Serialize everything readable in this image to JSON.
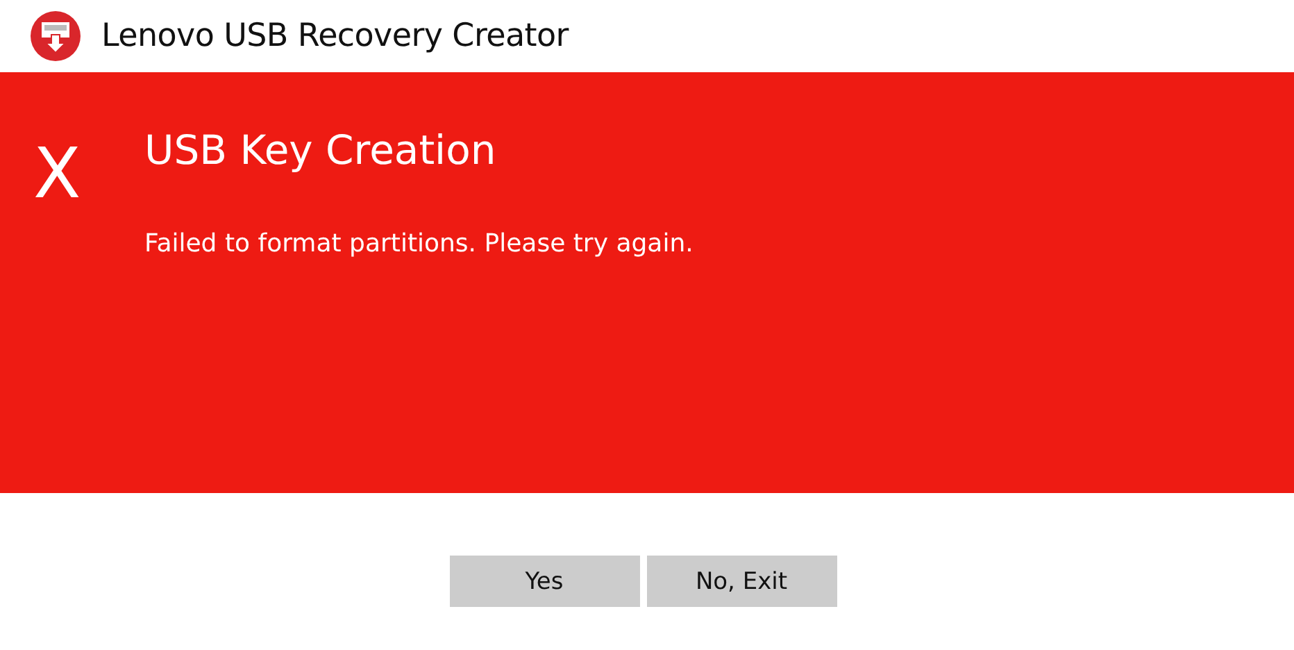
{
  "window": {
    "title": "Lenovo USB Recovery Creator"
  },
  "banner": {
    "status_mark": "X",
    "heading": "USB Key Creation",
    "message": "Failed to format partitions. Please try again."
  },
  "buttons": [
    "Yes",
    "No, Exit"
  ]
}
